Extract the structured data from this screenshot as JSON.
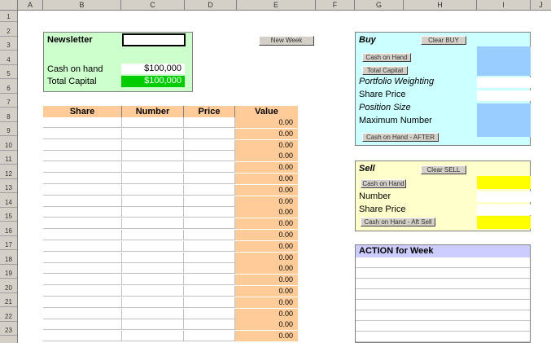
{
  "columns": [
    "A",
    "B",
    "C",
    "D",
    "E",
    "F",
    "G",
    "H",
    "I",
    "J"
  ],
  "rows": [
    "1",
    "2",
    "3",
    "4",
    "5",
    "6",
    "7",
    "8",
    "9",
    "10",
    "11",
    "12",
    "13",
    "14",
    "15",
    "16",
    "17",
    "18",
    "19",
    "20",
    "21",
    "22",
    "23"
  ],
  "newsletter": {
    "label": "Newsletter",
    "cash_label": "Cash on hand",
    "cash_value": "$100,000",
    "capital_label": "Total Capital",
    "capital_value": "$100,000"
  },
  "new_week_button": "New Week",
  "table": {
    "headers": [
      "Share",
      "Number",
      "Price",
      "Value"
    ],
    "values": [
      "0.00",
      "0.00",
      "0.00",
      "0.00",
      "0.00",
      "0.00",
      "0.00",
      "0.00",
      "0.00",
      "0.00",
      "0.00",
      "0.00",
      "0.00",
      "0.00",
      "0.00",
      "0.00",
      "0.00",
      "0.00",
      "0.00",
      "0.00"
    ]
  },
  "buy": {
    "title": "Buy",
    "clear_button": "Clear BUY",
    "cash_button": "Cash on Hand",
    "capital_button": "Total Capital",
    "weighting_label": "Portfolio Weighting",
    "price_label": "Share Price",
    "size_label": "Position Size",
    "max_label": "Maximum Number",
    "after_button": "Cash on Hand - AFTER"
  },
  "sell": {
    "title": "Sell",
    "clear_button": "Clear SELL",
    "cash_button": "Cash on Hand",
    "number_label": "Number",
    "price_label": "Share Price",
    "after_button": "Cash on Hand - Aft Sell"
  },
  "action": {
    "title": "ACTION for Week"
  },
  "colors": {
    "green_panel": "#ccffcc",
    "orange_header": "#ffcc99",
    "cyan_panel": "#ccffff",
    "yellow_panel": "#ffffcc",
    "lavender_header": "#ccccff"
  }
}
